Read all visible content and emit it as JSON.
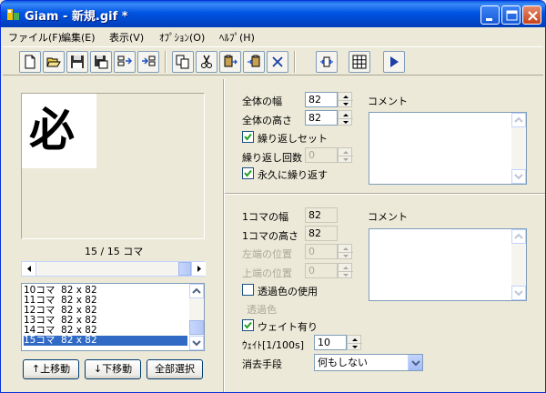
{
  "window": {
    "title": "Giam - 新規.gif *"
  },
  "menu": [
    "ファイル(F)",
    "編集(E)",
    "表示(V)",
    "ｵﾌﾟｼｮﾝ(O)",
    "ﾍﾙﾌﾟ(H)"
  ],
  "preview": {
    "glyph": "必"
  },
  "frame_counter": "15 / 15 コマ",
  "frames": [
    {
      "label": "10コマ  82 x 82"
    },
    {
      "label": "11コマ  82 x 82"
    },
    {
      "label": "12コマ  82 x 82"
    },
    {
      "label": "13コマ  82 x 82"
    },
    {
      "label": "14コマ  82 x 82"
    },
    {
      "label": "15コマ  82 x 82"
    }
  ],
  "buttons": {
    "move_up": "↑上移動",
    "move_down": "↓下移動",
    "select_all": "全部選択"
  },
  "global": {
    "width_label": "全体の幅",
    "width_value": "82",
    "height_label": "全体の高さ",
    "height_value": "82",
    "loop_set_label": "繰り返しセット",
    "loop_count_label": "繰り返し回数",
    "loop_count_value": "0",
    "loop_forever_label": "永久に繰り返す",
    "comment_label": "コメント"
  },
  "frame_props": {
    "width_label": "1コマの幅",
    "width_value": "82",
    "height_label": "1コマの高さ",
    "height_value": "82",
    "left_label": "左端の位置",
    "left_value": "0",
    "top_label": "上端の位置",
    "top_value": "0",
    "transparent_use_label": "透過色の使用",
    "transparent_color_label": "透過色",
    "wait_enable_label": "ウェイト有り",
    "wait_label": "ｳｪｲﾄ[1/100s]",
    "wait_value": "10",
    "dispose_label": "消去手段",
    "dispose_value": "何もしない",
    "comment_label": "コメント"
  }
}
